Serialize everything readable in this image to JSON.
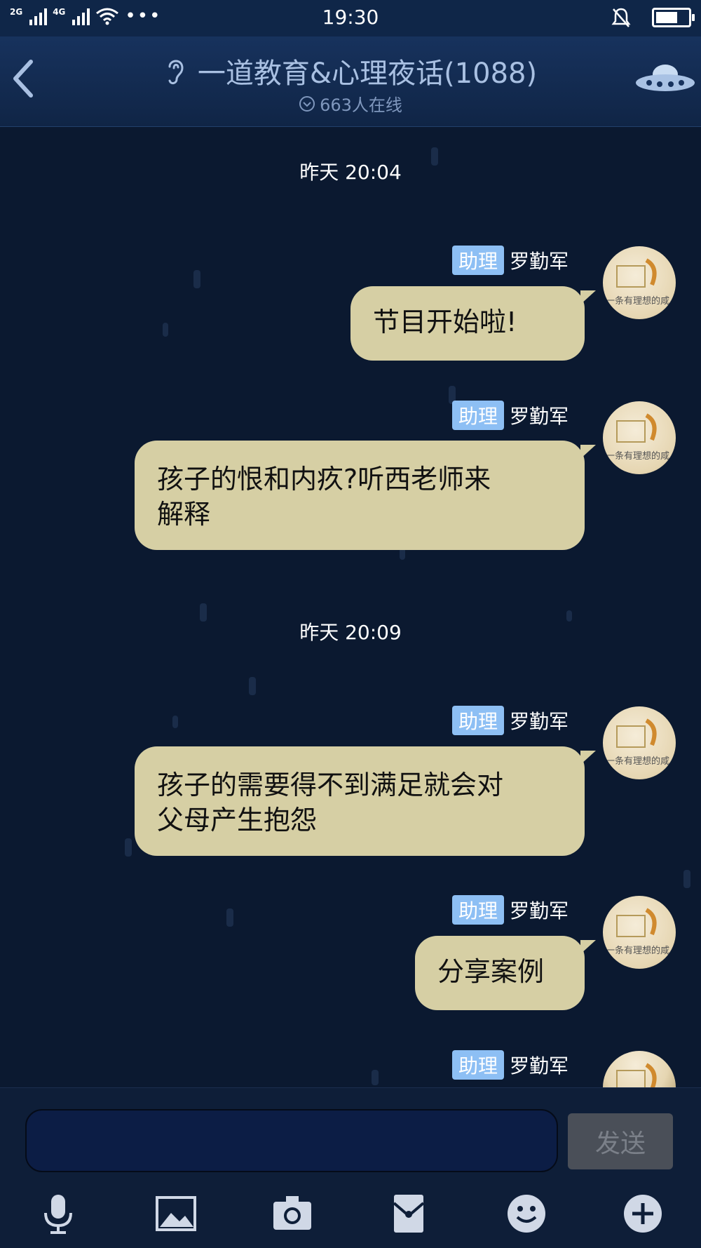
{
  "status_bar": {
    "sim1": "2G",
    "sim2": "4G",
    "time": "19:30"
  },
  "header": {
    "title": "一道教育&心理夜话(1088)",
    "online": "663人在线"
  },
  "messages": [
    {
      "type": "time",
      "text": "昨天 20:04"
    },
    {
      "type": "msg",
      "role": "助理",
      "sender": "罗勤军",
      "text": "节目开始啦!"
    },
    {
      "type": "msg",
      "role": "助理",
      "sender": "罗勤军",
      "lines": [
        "孩子的恨和内疚?听西老师来",
        "解释"
      ]
    },
    {
      "type": "time",
      "text": "昨天 20:09"
    },
    {
      "type": "msg",
      "role": "助理",
      "sender": "罗勤军",
      "lines": [
        "孩子的需要得不到满足就会对",
        "父母产生抱怨"
      ]
    },
    {
      "type": "msg",
      "role": "助理",
      "sender": "罗勤军",
      "text": "分享案例"
    },
    {
      "type": "msg",
      "role": "助理",
      "sender": "罗勤军"
    }
  ],
  "input": {
    "value": "",
    "send_label": "发送"
  },
  "icons": {
    "toolbar": [
      "microphone-icon",
      "image-icon",
      "camera-icon",
      "red-packet-icon",
      "emoji-icon",
      "plus-icon"
    ]
  }
}
